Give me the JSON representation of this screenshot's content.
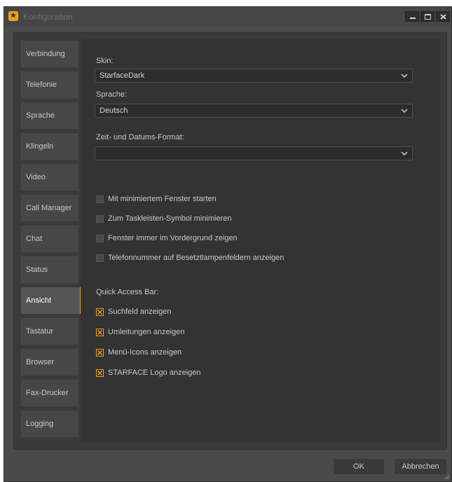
{
  "window": {
    "title": "Konfiguration"
  },
  "nav": {
    "items": [
      {
        "label": "Verbindung"
      },
      {
        "label": "Telefonie"
      },
      {
        "label": "Sprache"
      },
      {
        "label": "Klingeln"
      },
      {
        "label": "Video"
      },
      {
        "label": "Call Manager"
      },
      {
        "label": "Chat"
      },
      {
        "label": "Status"
      },
      {
        "label": "Ansicht",
        "active": true
      },
      {
        "label": "Tastatur"
      },
      {
        "label": "Browser"
      },
      {
        "label": "Fax-Drucker"
      },
      {
        "label": "Logging"
      }
    ]
  },
  "settings": {
    "skin": {
      "label": "Skin:",
      "value": "StarfaceDark"
    },
    "language": {
      "label": "Sprache:",
      "value": "Deutsch"
    },
    "time_format": {
      "label": "Zeit- und Datums-Format:",
      "value": ""
    },
    "options": [
      {
        "label": "Mit minimiertem Fenster starten",
        "checked": false
      },
      {
        "label": "Zum Taskleisten-Symbol minimieren",
        "checked": false
      },
      {
        "label": "Fenster immer im Vordergrund zeigen",
        "checked": false
      },
      {
        "label": "Telefonnummer auf Besetztlampenfeldern anzeigen",
        "checked": false
      }
    ],
    "quick_access": {
      "heading": "Quick Access Bar:",
      "items": [
        {
          "label": "Suchfeld anzeigen",
          "checked": true
        },
        {
          "label": "Umleitungen anzeigen",
          "checked": true
        },
        {
          "label": "Menü-Icons anzeigen",
          "checked": true
        },
        {
          "label": "STARFACE Logo anzeigen",
          "checked": true
        }
      ]
    }
  },
  "footer": {
    "ok_label": "OK",
    "cancel_label": "Abbrechen"
  },
  "colors": {
    "accent": "#f0a21a",
    "panel": "#333333",
    "window": "#4a4a4a"
  }
}
